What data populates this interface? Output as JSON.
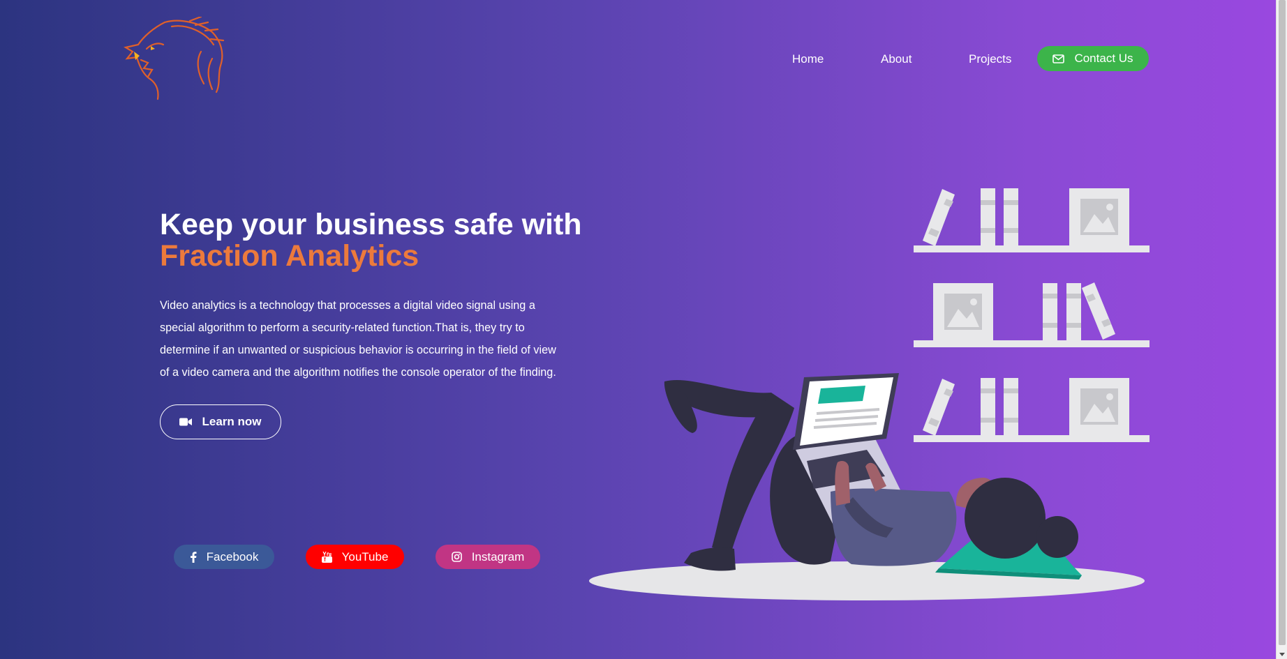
{
  "nav": {
    "items": [
      {
        "label": "Home"
      },
      {
        "label": "About"
      },
      {
        "label": "Projects"
      }
    ],
    "contact_label": "Contact Us"
  },
  "hero": {
    "title_line1": "Keep your business safe with",
    "title_line2": "Fraction Analytics",
    "description": "Video analytics is a technology that processes a digital video signal using a special algorithm to perform a security-related function.That is, they try to determine if an unwanted or suspicious behavior is occurring in the field of view of a video camera and the algorithm notifies the console operator of the finding.",
    "learn_label": "Learn now"
  },
  "social": {
    "facebook": "Facebook",
    "youtube": "YouTube",
    "instagram": "Instagram"
  },
  "icons": {
    "logo": "dragon-logo",
    "contact": "envelope-icon",
    "learn": "video-camera-icon",
    "facebook": "facebook-icon",
    "youtube": "youtube-icon",
    "instagram": "instagram-icon",
    "illustration": "woman-reading-laptop-illustration"
  },
  "colors": {
    "accent": "#ec7a3c",
    "contact_button": "#3cb44a",
    "facebook": "#3b5998",
    "youtube": "#ff0000",
    "instagram": "#c13584"
  }
}
